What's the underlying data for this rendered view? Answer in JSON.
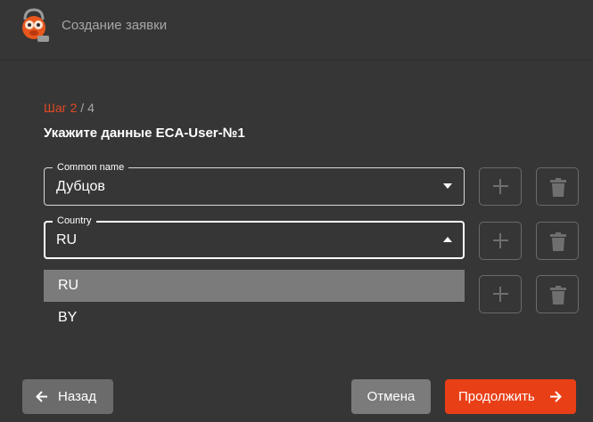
{
  "header": {
    "title": "Создание заявки"
  },
  "step": {
    "current": "Шаг 2",
    "separator": " / ",
    "total": "4"
  },
  "subtitle": "Укажите данные ECA-User-№1",
  "fields": [
    {
      "label": "Common name",
      "value": "Дубцов"
    },
    {
      "label": "Country",
      "value": "RU"
    }
  ],
  "dropdown": {
    "options": [
      "RU",
      "BY"
    ],
    "selected": "RU"
  },
  "buttons": {
    "back": "Назад",
    "cancel": "Отмена",
    "next": "Продолжить"
  },
  "colors": {
    "accent": "#e93f17",
    "background": "#363636"
  }
}
